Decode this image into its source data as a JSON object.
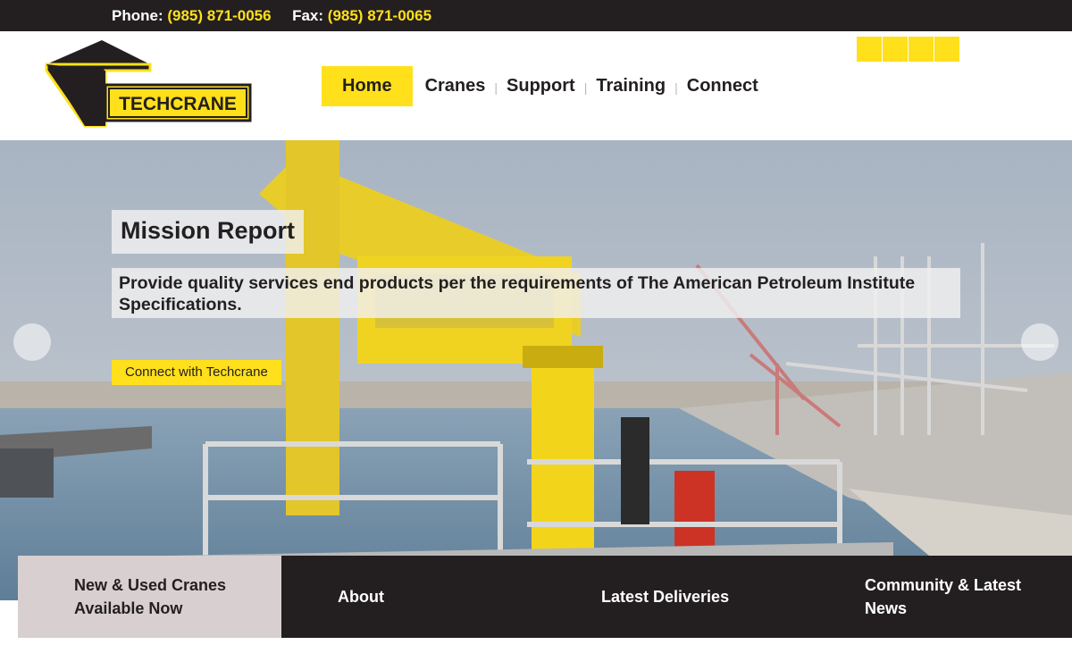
{
  "topbar": {
    "phone_label": "Phone:",
    "phone_number": "(985) 871-0056",
    "fax_label": "Fax:",
    "fax_number": "(985) 871-0065"
  },
  "brand": {
    "logo_text": "TECHCRANE",
    "accent_color": "#ffe01b",
    "dark_color": "#231f20"
  },
  "nav": {
    "items": [
      {
        "label": "Home",
        "active": true
      },
      {
        "label": "Cranes"
      },
      {
        "label": "Support"
      },
      {
        "label": "Training"
      },
      {
        "label": "Connect"
      }
    ],
    "separator": "|"
  },
  "social": {
    "icons": [
      "social-icon-1",
      "social-icon-2",
      "social-icon-3",
      "social-icon-4"
    ]
  },
  "hero": {
    "title": "Mission Report",
    "text": "Provide quality services end products per the requirements of The American Petroleum Institute Specifications.",
    "button_label": "Connect with Techcrane",
    "prev_icon": "chevron-left-icon",
    "next_icon": "chevron-right-icon"
  },
  "tiles": [
    {
      "label": "New & Used Cranes Available Now"
    },
    {
      "label": "About"
    },
    {
      "label": "Latest Deliveries"
    },
    {
      "label": "Community & Latest News"
    }
  ]
}
